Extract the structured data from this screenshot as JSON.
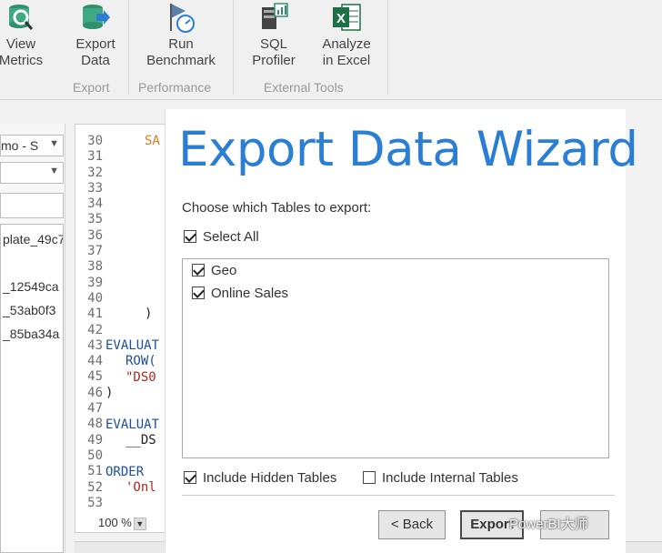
{
  "ribbon": {
    "buttons": [
      {
        "label1": "View",
        "label2": "Metrics",
        "icon": "database-magnifier-icon"
      },
      {
        "label1": "Export",
        "label2": "Data",
        "icon": "database-export-icon"
      },
      {
        "label1": "Run",
        "label2": "Benchmark",
        "icon": "benchmark-gauge-icon"
      },
      {
        "label1": "SQL",
        "label2": "Profiler",
        "icon": "sql-profiler-icon"
      },
      {
        "label1": "Analyze",
        "label2": "in Excel",
        "icon": "excel-icon"
      }
    ],
    "groups": [
      "Export",
      "Performance",
      "External Tools"
    ]
  },
  "left_panel": {
    "combo1": "mo - S",
    "tree_items": [
      "plate_49c7",
      "_12549ca",
      "_53ab0f3",
      "_85ba34a"
    ]
  },
  "editor": {
    "line_numbers": [
      "30",
      "31",
      "32",
      "33",
      "34",
      "35",
      "36",
      "37",
      "38",
      "39",
      "40",
      "41",
      "42",
      "43",
      "44",
      "45",
      "46",
      "47",
      "48",
      "49",
      "50",
      "51",
      "52",
      "53"
    ],
    "code": {
      "l30": "SA",
      "l41": ")",
      "l43": "EVALUAT",
      "l44": "ROW(",
      "l45": "\"DS0",
      "l46": ")",
      "l48": "EVALUAT",
      "l49": "__DS",
      "l51": "ORDER",
      "l52": "'Onl"
    },
    "zoom": "100 %"
  },
  "dialog": {
    "title": "Export Data Wizard",
    "instruction": "Choose which Tables to export:",
    "select_all": "Select All",
    "tables": [
      {
        "name": "Geo",
        "checked": true
      },
      {
        "name": "Online Sales",
        "checked": true
      }
    ],
    "include_hidden": "Include Hidden Tables",
    "include_internal": "Include Internal Tables",
    "back_button": "< Back",
    "export_button": "Export"
  },
  "watermark": "PowerBI大师"
}
